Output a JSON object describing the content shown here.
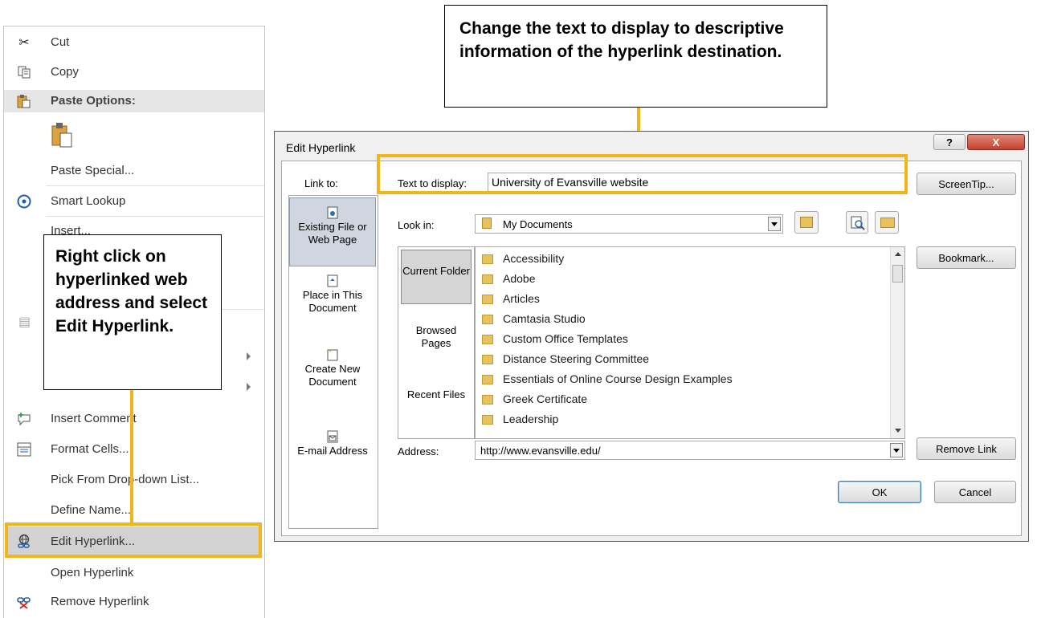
{
  "context_menu": {
    "items": [
      {
        "label": "Cut",
        "icon": "scissors-icon"
      },
      {
        "label": "Copy",
        "icon": "copy-icon"
      },
      {
        "label": "Paste Options:",
        "icon": "paste-icon"
      },
      {
        "label": "Paste Special...",
        "icon": ""
      },
      {
        "label": "Smart Lookup",
        "icon": "smart-lookup-icon"
      },
      {
        "label": "Insert...",
        "icon": ""
      },
      {
        "label": "Insert Comment",
        "icon": "comment-icon"
      },
      {
        "label": "Format Cells...",
        "icon": "format-cells-icon"
      },
      {
        "label": "Pick From Drop-down List...",
        "icon": ""
      },
      {
        "label": "Define Name...",
        "icon": ""
      },
      {
        "label": "Edit Hyperlink...",
        "icon": "edit-hyperlink-icon"
      },
      {
        "label": "Open Hyperlink",
        "icon": ""
      },
      {
        "label": "Remove Hyperlink",
        "icon": "remove-hyperlink-icon"
      }
    ]
  },
  "callouts": {
    "left": "Right click on hyperlinked web address and select Edit Hyperlink.",
    "top": "Change the text to display to descriptive information of the hyperlink destination."
  },
  "dialog": {
    "title": "Edit Hyperlink",
    "help_glyph": "?",
    "close_glyph": "X",
    "link_to_label": "Link to:",
    "text_to_display_label": "Text to display:",
    "text_to_display_value": "University of Evansville website",
    "screentip_label": "ScreenTip...",
    "look_in_label": "Look in:",
    "look_in_value": "My Documents",
    "bookmark_label": "Bookmark...",
    "remove_link_label": "Remove Link",
    "address_label": "Address:",
    "address_value": "http://www.evansville.edu/",
    "ok_label": "OK",
    "cancel_label": "Cancel",
    "nav": [
      {
        "label": "Existing File or Web Page"
      },
      {
        "label": "Place in This Document"
      },
      {
        "label": "Create New Document"
      },
      {
        "label": "E-mail Address"
      }
    ],
    "subnav": [
      {
        "label": "Current Folder"
      },
      {
        "label": "Browsed Pages"
      },
      {
        "label": "Recent Files"
      }
    ],
    "files": [
      "Accessibility",
      "Adobe",
      "Articles",
      "Camtasia Studio",
      "Custom Office Templates",
      "Distance Steering Committee",
      "Essentials of Online Course Design Examples",
      "Greek Certificate",
      "Leadership"
    ]
  }
}
